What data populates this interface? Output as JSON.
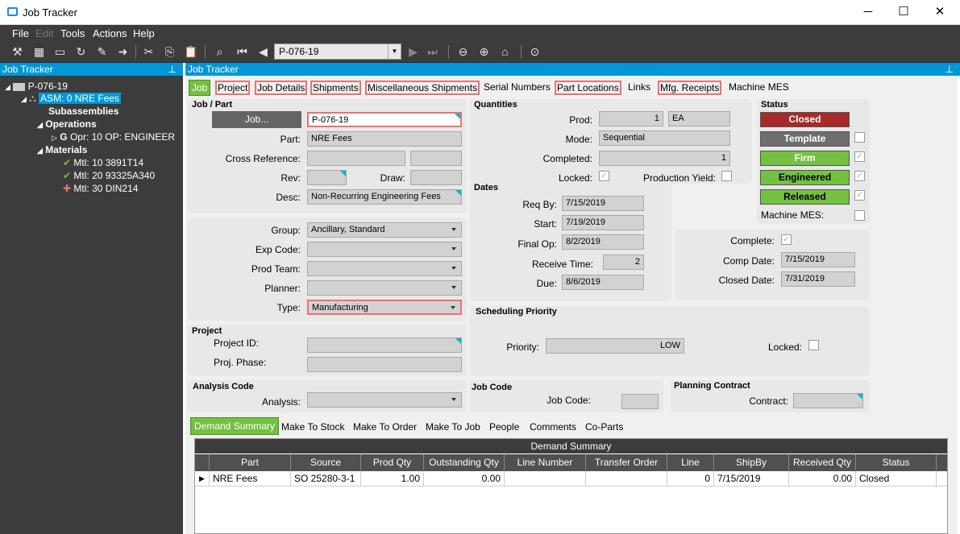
{
  "window": {
    "title": "Job Tracker",
    "minimize": "─",
    "maximize": "☐",
    "close": "✕"
  },
  "menu": [
    "File",
    "Edit",
    "Tools",
    "Actions",
    "Help"
  ],
  "toolbar": {
    "job_value": "P-076-19"
  },
  "left_panel": {
    "title": "Job Tracker",
    "tree": {
      "root": "P-076-19",
      "asm": "ASM: 0 NRE Fees",
      "subassemblies": "Subassemblies",
      "operations": "Operations",
      "opr": "Opr: 10 OP: ENGINEER",
      "materials": "Materials",
      "mtl": [
        "Mtl: 10 3891T14",
        "Mtl: 20 93325A340",
        "Mtl: 30 DIN214"
      ]
    }
  },
  "right_panel": {
    "title": "Job Tracker"
  },
  "tabs": [
    "Job",
    "Project",
    "Job Details",
    "Shipments",
    "Miscellaneous Shipments",
    "Serial Numbers",
    "Part Locations",
    "Links",
    "Mfg. Receipts",
    "Machine MES"
  ],
  "job_part": {
    "title": "Job / Part",
    "job_button": "Job...",
    "job": "P-076-19",
    "part_label": "Part:",
    "part": "NRE Fees",
    "xref_label": "Cross Reference:",
    "rev_label": "Rev:",
    "draw_label": "Draw:",
    "desc_label": "Desc:",
    "desc": "Non-Recurring Engineering Fees"
  },
  "classification": {
    "group_label": "Group:",
    "group": "Ancillary, Standard",
    "exp_label": "Exp Code:",
    "team_label": "Prod Team:",
    "planner_label": "Planner:",
    "type_label": "Type:",
    "type": "Manufacturing"
  },
  "project": {
    "title": "Project",
    "id_label": "Project ID:",
    "phase_label": "Proj. Phase:"
  },
  "analysis": {
    "title": "Analysis Code",
    "label": "Analysis:"
  },
  "quantities": {
    "title": "Quantities",
    "prod_label": "Prod:",
    "prod": "1",
    "uom": "EA",
    "mode_label": "Mode:",
    "mode": "Sequential",
    "completed_label": "Completed:",
    "completed": "1",
    "locked_label": "Locked:",
    "yield_label": "Production Yield:"
  },
  "dates": {
    "title": "Dates",
    "req_label": "Req By:",
    "req": "7/15/2019",
    "start_label": "Start:",
    "start": "7/19/2019",
    "final_label": "Final Op:",
    "final": "8/2/2019",
    "receive_label": "Receive Time:",
    "receive": "2",
    "due_label": "Due:",
    "due": "8/6/2019"
  },
  "status": {
    "title": "Status",
    "closed": "Closed",
    "template": "Template",
    "firm": "Firm",
    "engineered": "Engineered",
    "released": "Released",
    "mes_label": "Machine MES:",
    "colors": {
      "closed": "#a52a2a",
      "template": "#6e6e6e",
      "green": "#74c043"
    }
  },
  "completion": {
    "complete_label": "Complete:",
    "comp_date_label": "Comp Date:",
    "comp_date": "7/15/2019",
    "closed_date_label": "Closed Date:",
    "closed_date": "7/31/2019"
  },
  "scheduling": {
    "title": "Scheduling Priority",
    "priority_label": "Priority:",
    "priority": "LOW",
    "locked_label": "Locked:"
  },
  "job_code": {
    "title": "Job Code",
    "label": "Job Code:"
  },
  "planning": {
    "title": "Planning Contract",
    "label": "Contract:"
  },
  "bottom_tabs": [
    "Demand Summary",
    "Make To Stock",
    "Make To Order",
    "Make To Job",
    "People",
    "Comments",
    "Co-Parts"
  ],
  "demand_grid": {
    "title": "Demand Summary",
    "columns": [
      "Part",
      "Source",
      "Prod Qty",
      "Outstanding Qty",
      "Line Number",
      "Transfer Order",
      "Line",
      "ShipBy",
      "Received Qty",
      "Status"
    ],
    "rows": [
      [
        "NRE Fees",
        "SO 25280-3-1",
        "1.00",
        "0.00",
        "",
        "",
        "0",
        "7/15/2019",
        "0.00",
        "Closed"
      ]
    ]
  }
}
